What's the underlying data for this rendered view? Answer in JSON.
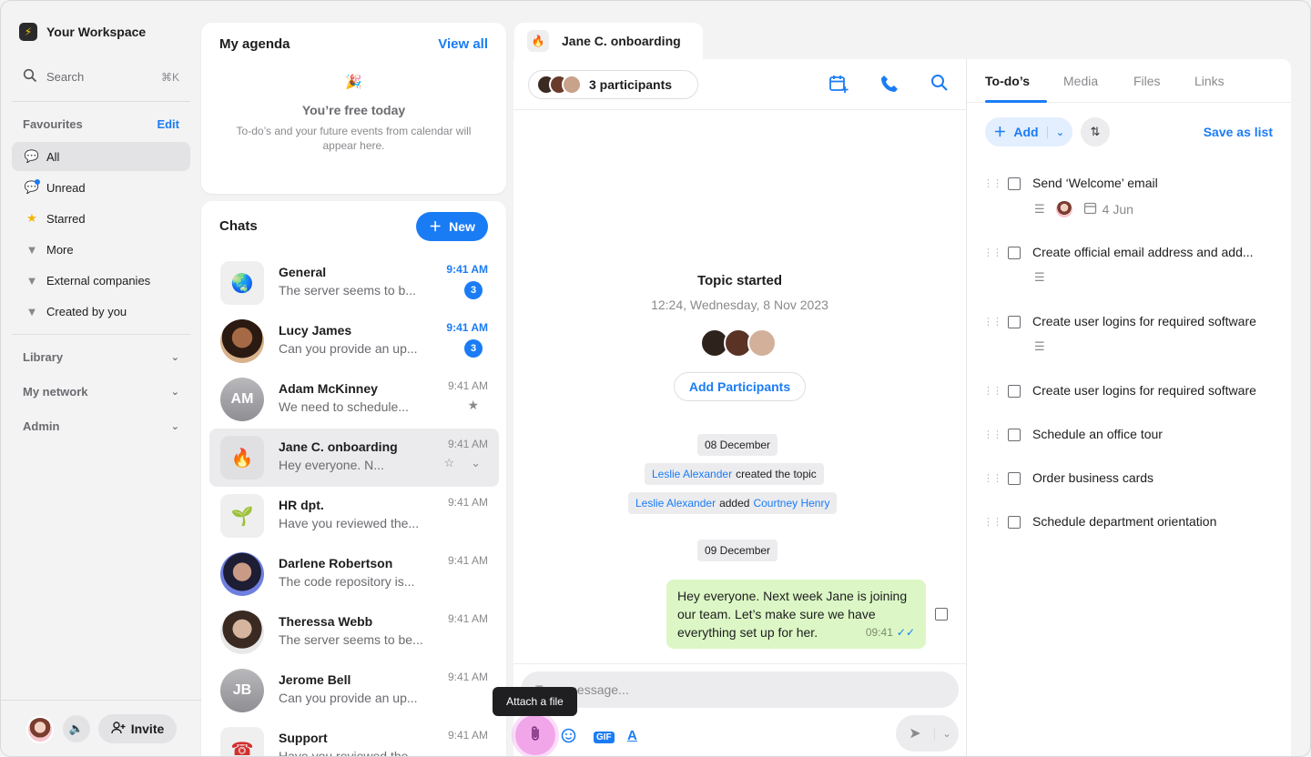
{
  "workspace": {
    "name": "Your Workspace"
  },
  "sidebar": {
    "search_label": "Search",
    "search_shortcut": "⌘K",
    "favourites_title": "Favourites",
    "edit_label": "Edit",
    "items": [
      {
        "label": "All",
        "icon": "chat-bubble-icon"
      },
      {
        "label": "Unread",
        "icon": "chat-bubble-unread-icon"
      },
      {
        "label": "Starred",
        "icon": "star-icon"
      },
      {
        "label": "More",
        "icon": "caret-down-icon"
      },
      {
        "label": "External companies",
        "icon": "caret-down-icon"
      },
      {
        "label": "Created by you",
        "icon": "caret-down-icon"
      }
    ],
    "groups": [
      {
        "label": "Library"
      },
      {
        "label": "My network"
      },
      {
        "label": "Admin"
      }
    ],
    "invite_label": "Invite"
  },
  "agenda": {
    "title": "My agenda",
    "view_all": "View all",
    "free_title": "You’re free today",
    "description": "To-do’s and your future events from calendar will appear here."
  },
  "chats": {
    "title": "Chats",
    "new_label": "New",
    "list": [
      {
        "name": "General",
        "preview": "The server seems to b...",
        "time": "9:41 AM",
        "unread": "3"
      },
      {
        "name": "Lucy James",
        "preview": "Can you provide an up...",
        "time": "9:41 AM",
        "unread": "3"
      },
      {
        "name": "Adam McKinney",
        "initials": "AM",
        "preview": "We need to schedule...",
        "time": "9:41 AM"
      },
      {
        "name": "Jane C. onboarding",
        "preview": "Hey everyone. N...",
        "time": "9:41 AM"
      },
      {
        "name": "HR dpt.",
        "preview": "Have you reviewed the...",
        "time": "9:41 AM"
      },
      {
        "name": "Darlene Robertson",
        "preview": "The code repository is...",
        "time": "9:41 AM"
      },
      {
        "name": "Theressa Webb",
        "preview": "The server seems to be...",
        "time": "9:41 AM"
      },
      {
        "name": "Jerome Bell",
        "initials": "JB",
        "preview": "Can you provide an up...",
        "time": "9:41 AM"
      },
      {
        "name": "Support",
        "preview": "Have you reviewed the...",
        "time": "9:41 AM"
      }
    ]
  },
  "conversation": {
    "tab_title": "Jane C. onboarding",
    "participants_label": "3 participants",
    "topic_title": "Topic started",
    "topic_time": "12:24, Wednesday, 8 Nov 2023",
    "add_participants": "Add Participants",
    "date1": "08 December",
    "event1_user": "Leslie Alexander",
    "event1_text": "created the topic",
    "event2_user": "Leslie Alexander",
    "event2_text": "added",
    "event2_target": "Courtney Henry",
    "date2": "09 December",
    "message": "Hey everyone. Next week Jane is joining our team. Let’s make sure we have everything set up for her.",
    "message_time": "09:41",
    "input_placeholder": "Type message...",
    "tooltip": "Attach a file",
    "gif_label": "GIF",
    "format_label": "A"
  },
  "todo": {
    "tabs": [
      "To-do’s",
      "Media",
      "Files",
      "Links"
    ],
    "add_label": "Add",
    "save_as_list": "Save as list",
    "items": [
      {
        "text": "Send ‘Welcome’ email",
        "date": "4 Jun"
      },
      {
        "text": "Create official email address and add..."
      },
      {
        "text": "Create user logins for required software"
      },
      {
        "text": "Create user logins for required software"
      },
      {
        "text": "Schedule an office tour"
      },
      {
        "text": "Order business cards"
      },
      {
        "text": "Schedule department orientation"
      }
    ]
  },
  "colors": {
    "accent": "#1a7cf5",
    "bubble": "#dcf7c5",
    "attach": "#f0a6e9"
  }
}
